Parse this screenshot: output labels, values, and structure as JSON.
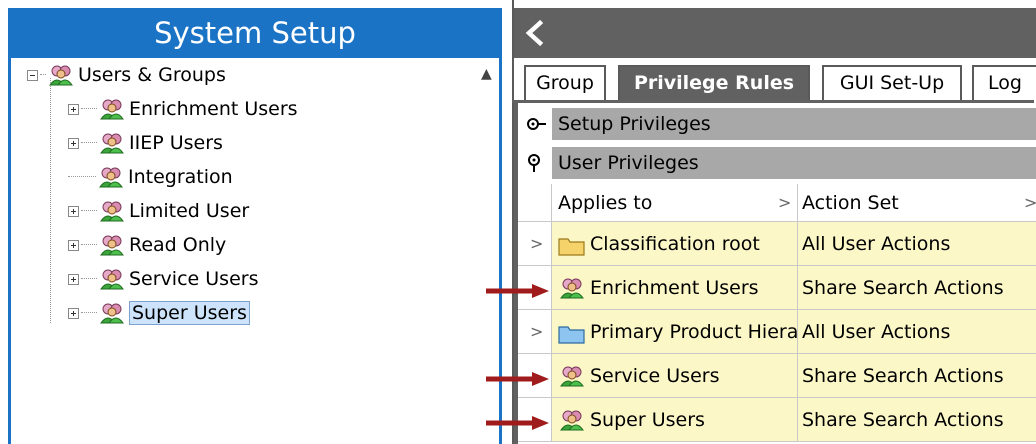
{
  "left": {
    "title": "System Setup",
    "tree": {
      "root": "Users & Groups",
      "children": [
        "Enrichment Users",
        "IIEP Users",
        "Integration",
        "Limited User",
        "Read Only",
        "Service Users",
        "Super Users"
      ],
      "selected": "Super Users"
    }
  },
  "right": {
    "tabs": [
      "Group",
      "Privilege Rules",
      "GUI Set-Up",
      "Log"
    ],
    "active_tab": "Privilege Rules",
    "sections": {
      "setup": "Setup Privileges",
      "user": "User Privileges"
    },
    "grid": {
      "columns": [
        "Applies to",
        "Action Set"
      ],
      "rows": [
        {
          "applies_to": "Classification root",
          "action_set": "All User Actions"
        },
        {
          "applies_to": "Enrichment Users",
          "action_set": "Share Search Actions"
        },
        {
          "applies_to": "Primary Product Hiera",
          "action_set": "All User Actions"
        },
        {
          "applies_to": "Service Users",
          "action_set": "Share Search Actions"
        },
        {
          "applies_to": "Super Users",
          "action_set": "Share Search Actions"
        }
      ]
    }
  },
  "colors": {
    "header_blue": "#1b73c6",
    "tab_gray": "#616161",
    "row_yellow": "#fbf7c7",
    "arrow_red": "#a01b1b",
    "selection": "#cce3fb"
  }
}
